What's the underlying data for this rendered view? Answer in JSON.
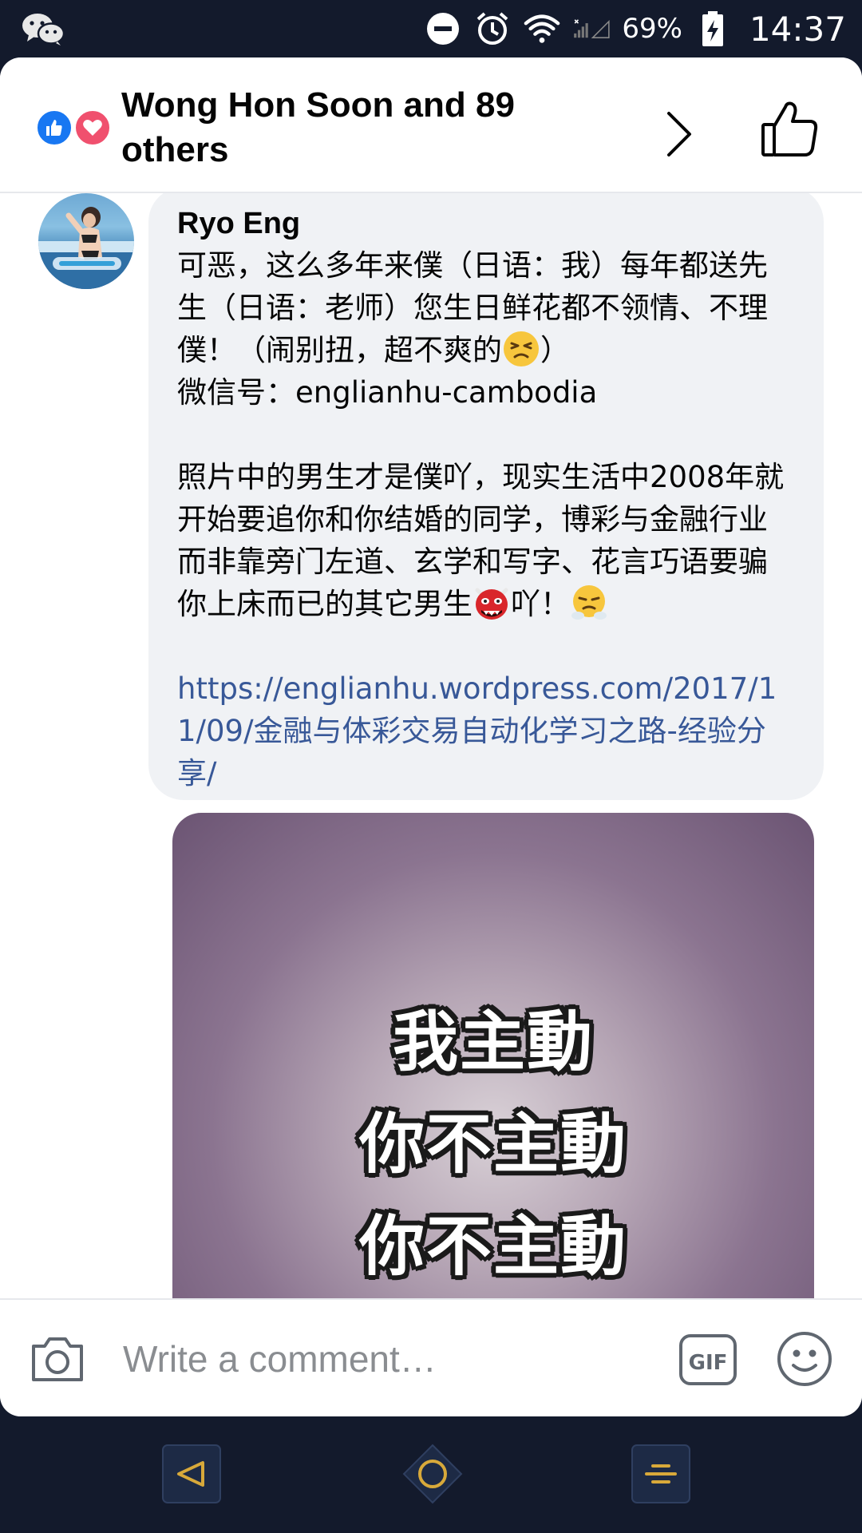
{
  "status_bar": {
    "battery_percent": "69%",
    "time": "14:37",
    "icons": [
      "wechat-icon",
      "do-not-disturb-icon",
      "alarm-icon",
      "wifi-icon",
      "signal-icon",
      "battery-charging-icon"
    ]
  },
  "header": {
    "reactions_text": "Wong Hon Soon and 89 others",
    "reaction_icons": [
      "like-icon",
      "love-icon"
    ]
  },
  "comment": {
    "author": "Ryo Eng",
    "text_part1": "可恶，这么多年来僕（日语：我）每年都送先生（日语：老师）您生日鲜花都不领情、不理僕！（闹别扭，超不爽的",
    "text_part2": "）\n微信号：englianhu-cambodia\n\n照片中的男生才是僕吖，现实生活中2008年就开始要追你和你结婚的同学，博彩与金融行业而非靠旁门左道、玄学和写字、花言巧语要骗你上床而已的其它男生",
    "text_part3": "吖！",
    "link": "https://englianhu.wordpress.com/2017/11/09/金融与体彩交易自动化学习之路-经验分享/",
    "photo_lines": [
      "我主動",
      "你不主動",
      "你不主動"
    ]
  },
  "composer": {
    "placeholder": "Write a comment…"
  },
  "colors": {
    "status_bar_bg": "#131a2c",
    "like_blue": "#1877f2",
    "love_red": "#f0506e",
    "link_blue": "#385898",
    "bubble_bg": "#f0f2f5"
  }
}
